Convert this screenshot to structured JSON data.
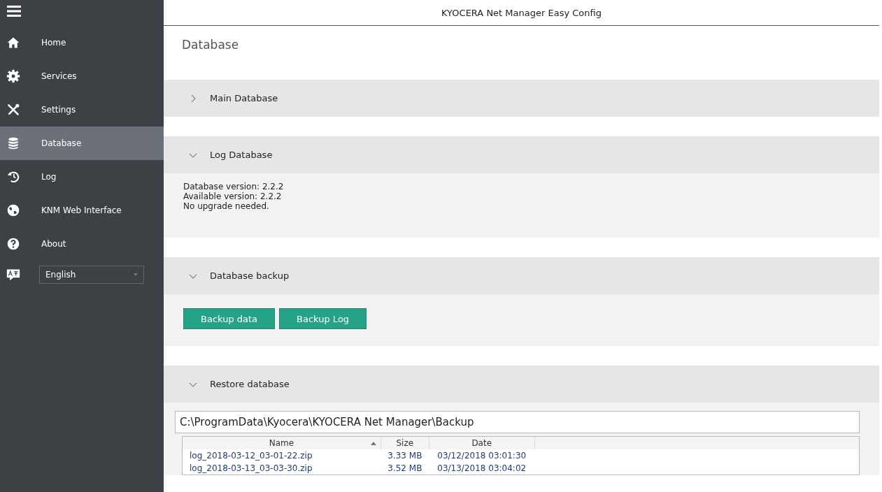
{
  "window": {
    "title": "KYOCERA Net Manager Easy Config"
  },
  "sidebar": {
    "items": [
      {
        "label": "Home",
        "selected": false
      },
      {
        "label": "Services",
        "selected": false
      },
      {
        "label": "Settings",
        "selected": false
      },
      {
        "label": "Database",
        "selected": true
      },
      {
        "label": "Log",
        "selected": false
      },
      {
        "label": "KNM Web Interface",
        "selected": false
      },
      {
        "label": "About",
        "selected": false
      }
    ],
    "language": {
      "value": "English"
    }
  },
  "page_title": "Database",
  "sections": [
    {
      "title": "Main Database",
      "expanded": false
    },
    {
      "kind": "info",
      "title": "Log Database",
      "expanded": true,
      "lines": [
        "Database version: 2.2.2",
        "Available version:  2.2.2",
        "No upgrade needed."
      ]
    },
    {
      "kind": "buttons",
      "title": "Database backup",
      "expanded": true,
      "buttons": [
        "Backup data",
        "Backup Log"
      ]
    },
    {
      "kind": "files",
      "title": "Restore database",
      "expanded": true,
      "path": "C:\\ProgramData\\Kyocera\\KYOCERA Net Manager\\Backup",
      "table": {
        "columns": [
          {
            "label": "Name",
            "sorted": true
          },
          {
            "label": "Size",
            "sorted": false
          },
          {
            "label": "Date",
            "sorted": false
          }
        ],
        "rows": [
          [
            "log_2018-03-12_03-01-22.zip",
            "3.33 MB",
            "03/12/2018 03:01:30"
          ],
          [
            "log_2018-03-13_03-03-30.zip",
            "3.52 MB",
            "03/13/2018 03:04:02"
          ]
        ]
      }
    }
  ]
}
